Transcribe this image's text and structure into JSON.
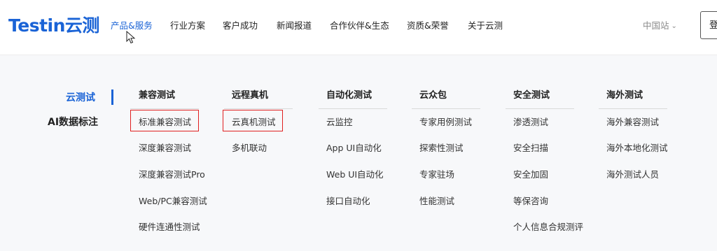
{
  "header": {
    "logo": "Testin云测",
    "nav": [
      "产品&服务",
      "行业方案",
      "客户成功",
      "新闻报道",
      "合作伙伴&生态",
      "资质&荣誉",
      "关于云测"
    ],
    "active_nav": "产品&服务",
    "region": "中国站",
    "login": "登"
  },
  "sidebar": {
    "categories": [
      "云测试",
      "AI数据标注"
    ],
    "active": "云测试"
  },
  "columns": [
    {
      "title": "兼容测试",
      "items": [
        "标准兼容测试",
        "深度兼容测试",
        "深度兼容测试Pro",
        "Web/PC兼容测试",
        "硬件连通性测试"
      ]
    },
    {
      "title": "远程真机",
      "items": [
        "云真机测试",
        "多机联动"
      ]
    },
    {
      "title": "自动化测试",
      "items": [
        "云监控",
        "App UI自动化",
        "Web UI自动化",
        "接口自动化"
      ]
    },
    {
      "title": "云众包",
      "items": [
        "专家用例测试",
        "探索性测试",
        "专家驻场",
        "性能测试"
      ]
    },
    {
      "title": "安全测试",
      "items": [
        "渗透测试",
        "安全扫描",
        "安全加固",
        "等保咨询",
        "个人信息合规测评"
      ]
    },
    {
      "title": "海外测试",
      "items": [
        "海外兼容测试",
        "海外本地化测试",
        "海外测试人员"
      ]
    }
  ],
  "colors": {
    "accent": "#1a63d6",
    "highlight": "#e02020"
  }
}
